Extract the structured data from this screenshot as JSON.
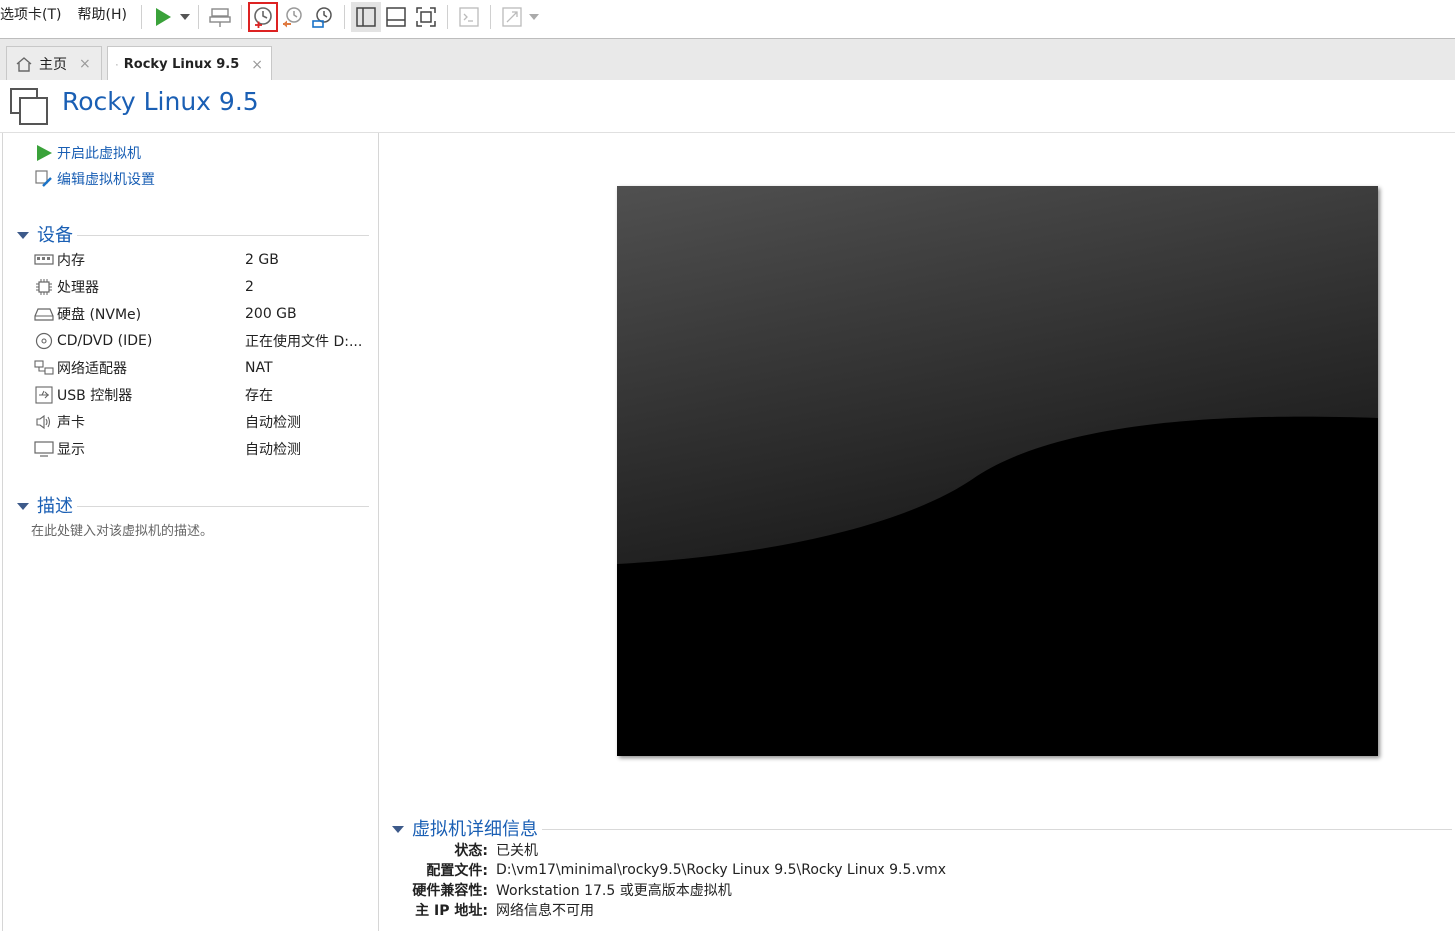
{
  "menu": {
    "tabs_menu": "选项卡(T)",
    "help_menu": "帮助(H)"
  },
  "tabs": [
    {
      "label": "主页",
      "close": "×"
    },
    {
      "label": "Rocky Linux 9.5",
      "close": "×"
    }
  ],
  "vm": {
    "title": "Rocky Linux 9.5"
  },
  "actions": {
    "power_on": "开启此虚拟机",
    "edit_settings": "编辑虚拟机设置"
  },
  "devices": {
    "heading": "设备",
    "items": [
      {
        "icon": "memory-icon",
        "name": "内存",
        "value": "2 GB"
      },
      {
        "icon": "cpu-icon",
        "name": "处理器",
        "value": "2"
      },
      {
        "icon": "hard-disk-icon",
        "name": "硬盘 (NVMe)",
        "value": "200 GB"
      },
      {
        "icon": "cd-dvd-icon",
        "name": "CD/DVD (IDE)",
        "value": "正在使用文件 D:..."
      },
      {
        "icon": "network-adapter-icon",
        "name": "网络适配器",
        "value": "NAT"
      },
      {
        "icon": "usb-icon",
        "name": "USB 控制器",
        "value": "存在"
      },
      {
        "icon": "sound-card-icon",
        "name": "声卡",
        "value": "自动检测"
      },
      {
        "icon": "display-icon",
        "name": "显示",
        "value": "自动检测"
      }
    ]
  },
  "description": {
    "heading": "描述",
    "placeholder": "在此处键入对该虚拟机的描述。"
  },
  "details": {
    "heading": "虚拟机详细信息",
    "rows": [
      {
        "key": "状态:",
        "value": "已关机"
      },
      {
        "key": "配置文件:",
        "value": "D:\\vm17\\minimal\\rocky9.5\\Rocky Linux 9.5\\Rocky Linux 9.5.vmx"
      },
      {
        "key": "硬件兼容性:",
        "value": "Workstation 17.5 或更高版本虚拟机"
      },
      {
        "key": "主 IP 地址:",
        "value": "网络信息不可用"
      }
    ]
  },
  "colors": {
    "accent": "#1a5fb4",
    "play_green": "#3aa23a",
    "highlight_red": "#d22222"
  }
}
